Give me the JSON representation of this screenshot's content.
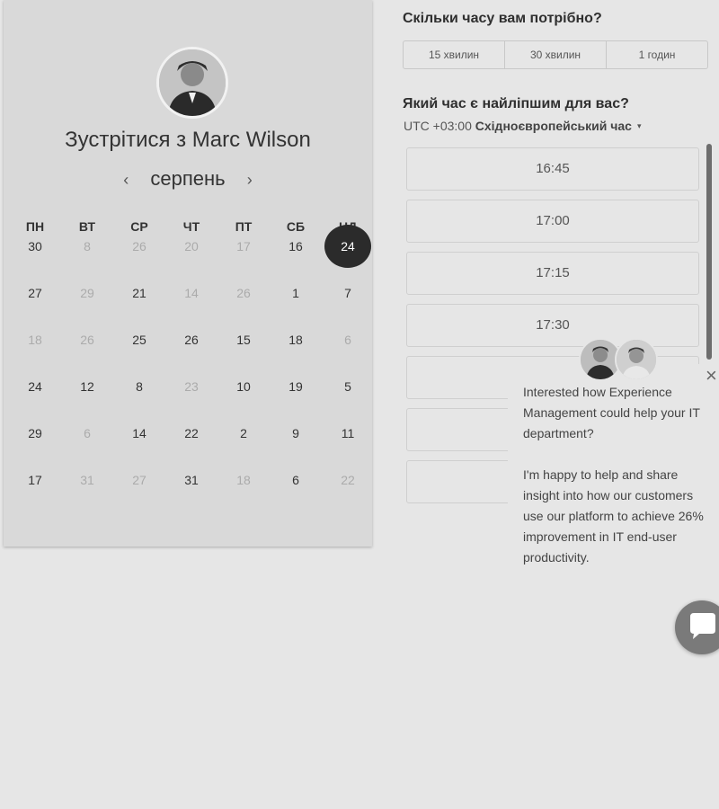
{
  "booking": {
    "title": "Зустрітися з Marc Wilson",
    "month": "серпень",
    "prev_icon": "‹",
    "next_icon": "›",
    "weekdays": [
      "ПН",
      "ВТ",
      "СР",
      "ЧТ",
      "ПТ",
      "СБ",
      "НД"
    ],
    "weeks": [
      [
        {
          "d": "30",
          "off": false
        },
        {
          "d": "8",
          "off": true
        },
        {
          "d": "26",
          "off": true
        },
        {
          "d": "20",
          "off": true
        },
        {
          "d": "17",
          "off": true
        },
        {
          "d": "16",
          "off": false
        },
        {
          "d": "24",
          "off": false,
          "selected": true
        }
      ],
      [
        {
          "d": "27",
          "off": false
        },
        {
          "d": "29",
          "off": true
        },
        {
          "d": "21",
          "off": false
        },
        {
          "d": "14",
          "off": true
        },
        {
          "d": "26",
          "off": true
        },
        {
          "d": "1",
          "off": false
        },
        {
          "d": "7",
          "off": false
        }
      ],
      [
        {
          "d": "18",
          "off": true
        },
        {
          "d": "26",
          "off": true
        },
        {
          "d": "25",
          "off": false
        },
        {
          "d": "26",
          "off": false
        },
        {
          "d": "15",
          "off": false
        },
        {
          "d": "18",
          "off": false
        },
        {
          "d": "6",
          "off": true
        }
      ],
      [
        {
          "d": "24",
          "off": false
        },
        {
          "d": "12",
          "off": false
        },
        {
          "d": "8",
          "off": false
        },
        {
          "d": "23",
          "off": true
        },
        {
          "d": "10",
          "off": false
        },
        {
          "d": "19",
          "off": false
        },
        {
          "d": "5",
          "off": false
        }
      ],
      [
        {
          "d": "29",
          "off": false
        },
        {
          "d": "6",
          "off": true
        },
        {
          "d": "14",
          "off": false
        },
        {
          "d": "22",
          "off": false
        },
        {
          "d": "2",
          "off": false
        },
        {
          "d": "9",
          "off": false
        },
        {
          "d": "11",
          "off": false
        }
      ],
      [
        {
          "d": "17",
          "off": false
        },
        {
          "d": "31",
          "off": true
        },
        {
          "d": "27",
          "off": true
        },
        {
          "d": "31",
          "off": false
        },
        {
          "d": "18",
          "off": true
        },
        {
          "d": "6",
          "off": false
        },
        {
          "d": "22",
          "off": true
        }
      ]
    ]
  },
  "duration": {
    "heading": "Скільки часу вам потрібно?",
    "options": [
      "15 хвилин",
      "30 хвилин",
      "1 годин"
    ]
  },
  "time": {
    "heading": "Який час є найліпшим для вас?",
    "tz_offset": "UTC +03:00",
    "tz_name": "Східноєвропейський час",
    "tz_caret": "▾",
    "slots": [
      "16:45",
      "17:00",
      "17:15",
      "17:30",
      "",
      "",
      "",
      ""
    ]
  },
  "chat": {
    "close": "×",
    "message_1": "Interested how Experience Management could help your IT department?",
    "message_2": "I'm happy to help and share insight into how our customers use our platform to achieve 26% improvement in IT end-user productivity."
  }
}
